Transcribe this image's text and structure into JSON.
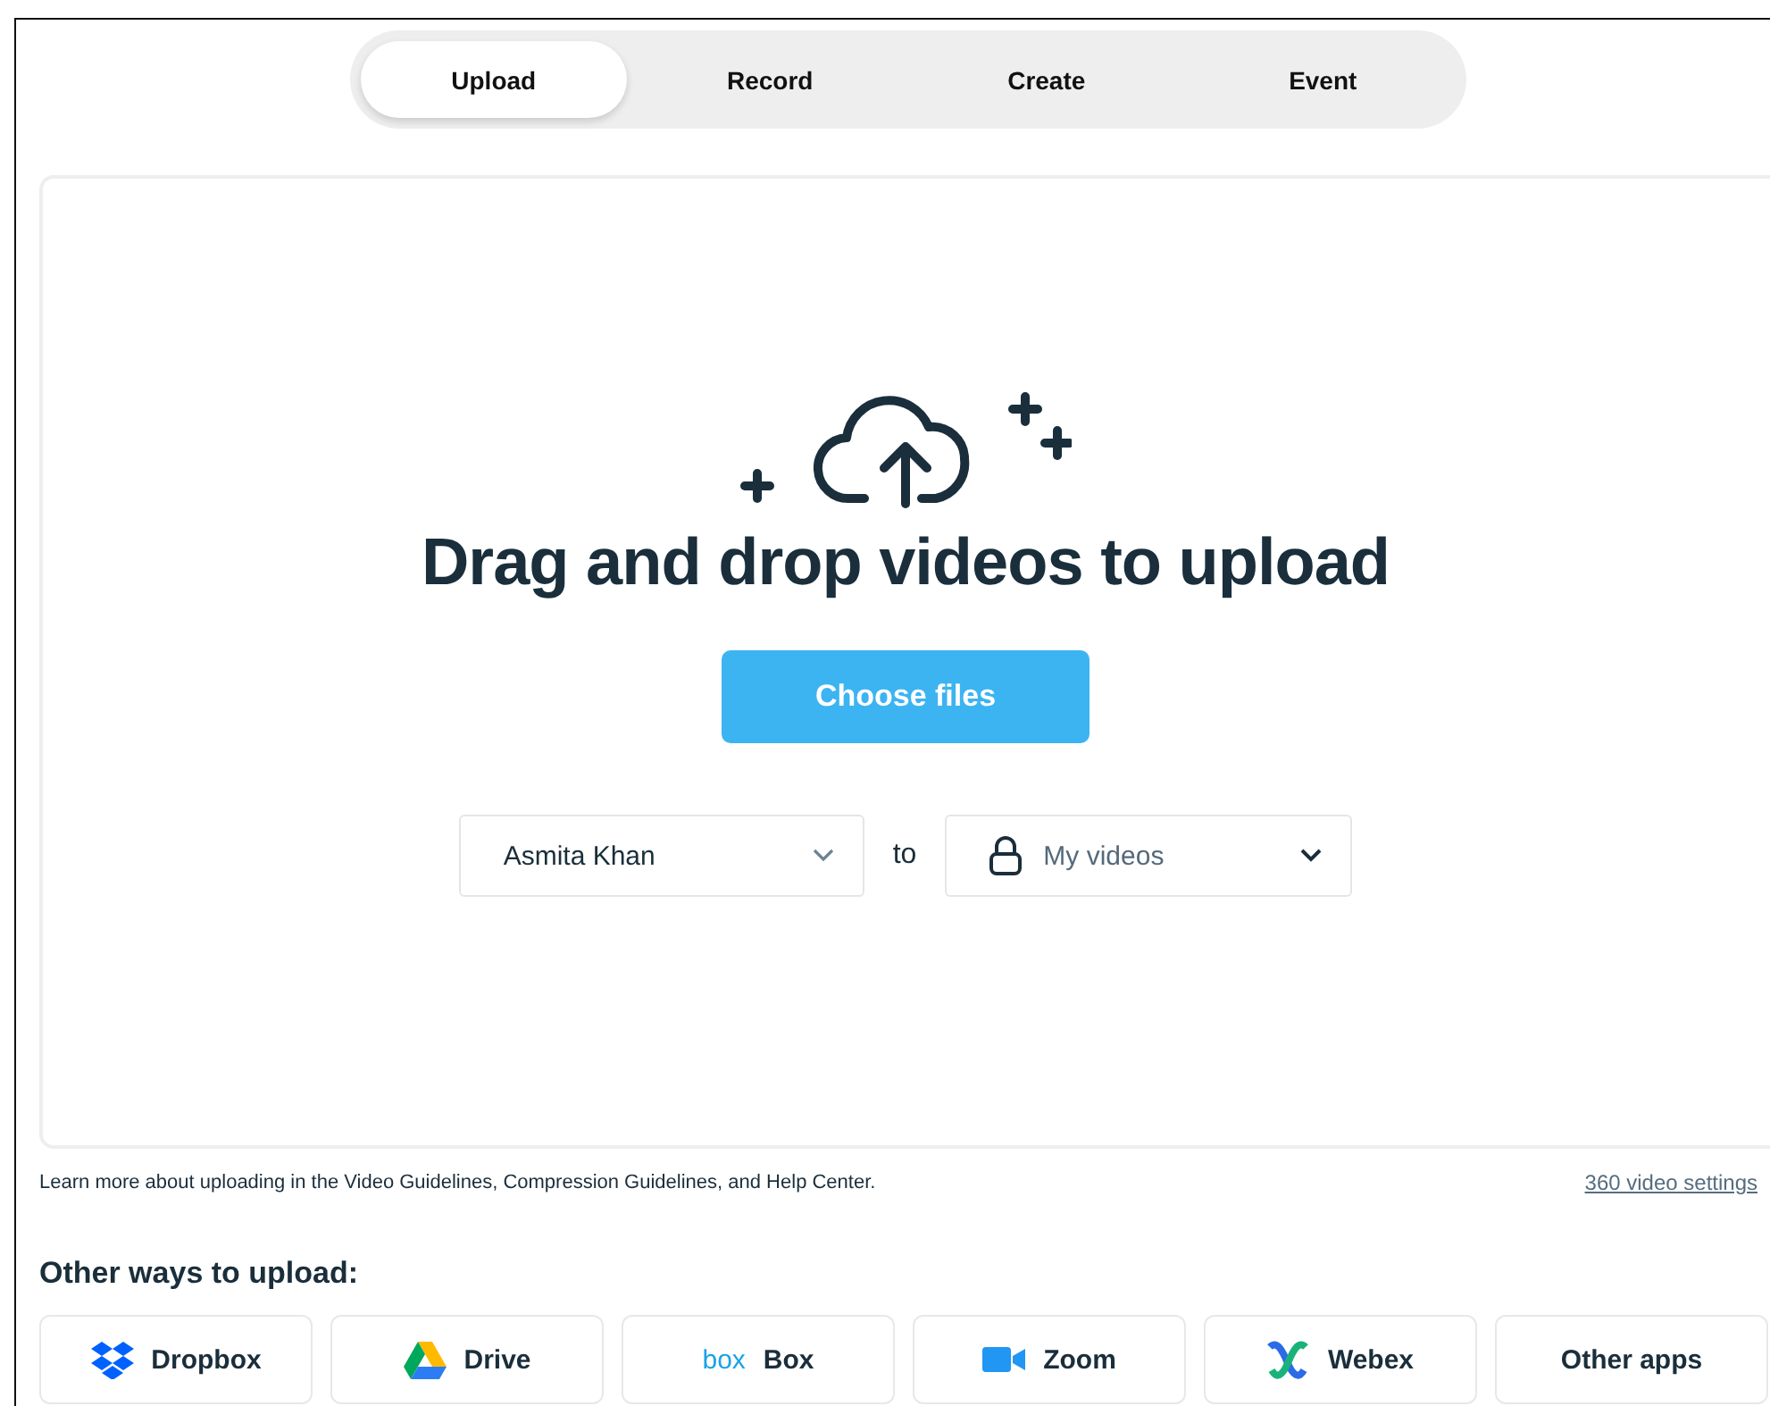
{
  "tabs": [
    {
      "label": "Upload",
      "selected": true
    },
    {
      "label": "Record",
      "selected": false
    },
    {
      "label": "Create",
      "selected": false
    },
    {
      "label": "Event",
      "selected": false
    }
  ],
  "dropzone": {
    "heading": "Drag and drop videos to upload",
    "button": "Choose files",
    "owner": "Asmita Khan",
    "connector": "to",
    "destination": "My videos"
  },
  "footnote": "Learn more about uploading in the Video Guidelines, Compression Guidelines, and Help Center.",
  "settings_link": "360 video settings",
  "other_ways": {
    "title": "Other ways to upload:",
    "sources": [
      {
        "kind": "dropbox",
        "label": "Dropbox"
      },
      {
        "kind": "drive",
        "label": "Drive"
      },
      {
        "kind": "box",
        "logo": "box",
        "label": "Box"
      },
      {
        "kind": "zoom",
        "label": "Zoom"
      },
      {
        "kind": "webex",
        "label": "Webex"
      },
      {
        "kind": "other",
        "label": "Other apps"
      }
    ]
  }
}
